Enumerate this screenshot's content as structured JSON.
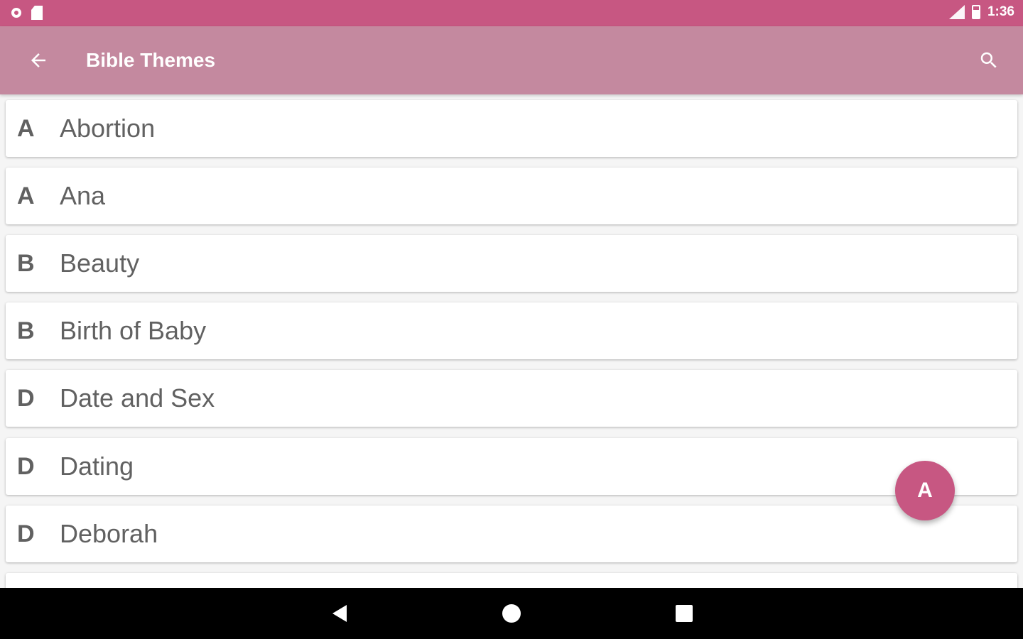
{
  "status_bar": {
    "time": "1:36",
    "left_icons": [
      "circle-icon",
      "sd-card-icon"
    ],
    "right_icons": [
      "signal-icon",
      "battery-icon"
    ]
  },
  "toolbar": {
    "title": "Bible Themes",
    "back_icon": "arrow-back-icon",
    "search_icon": "search-icon"
  },
  "list": {
    "items": [
      {
        "letter": "A",
        "name": "Abortion"
      },
      {
        "letter": "A",
        "name": "Ana"
      },
      {
        "letter": "B",
        "name": "Beauty"
      },
      {
        "letter": "B",
        "name": "Birth of Baby"
      },
      {
        "letter": "D",
        "name": "Date and Sex"
      },
      {
        "letter": "D",
        "name": "Dating"
      },
      {
        "letter": "D",
        "name": "Deborah"
      }
    ]
  },
  "fab": {
    "label": "A"
  },
  "colors": {
    "status_bar": "#c75782",
    "toolbar": "#c4899f",
    "accent": "#c75782",
    "item_text": "#616161",
    "background": "#f5f5f5"
  },
  "nav_bar": {
    "icons": [
      "nav-back-icon",
      "nav-home-icon",
      "nav-recents-icon"
    ]
  }
}
